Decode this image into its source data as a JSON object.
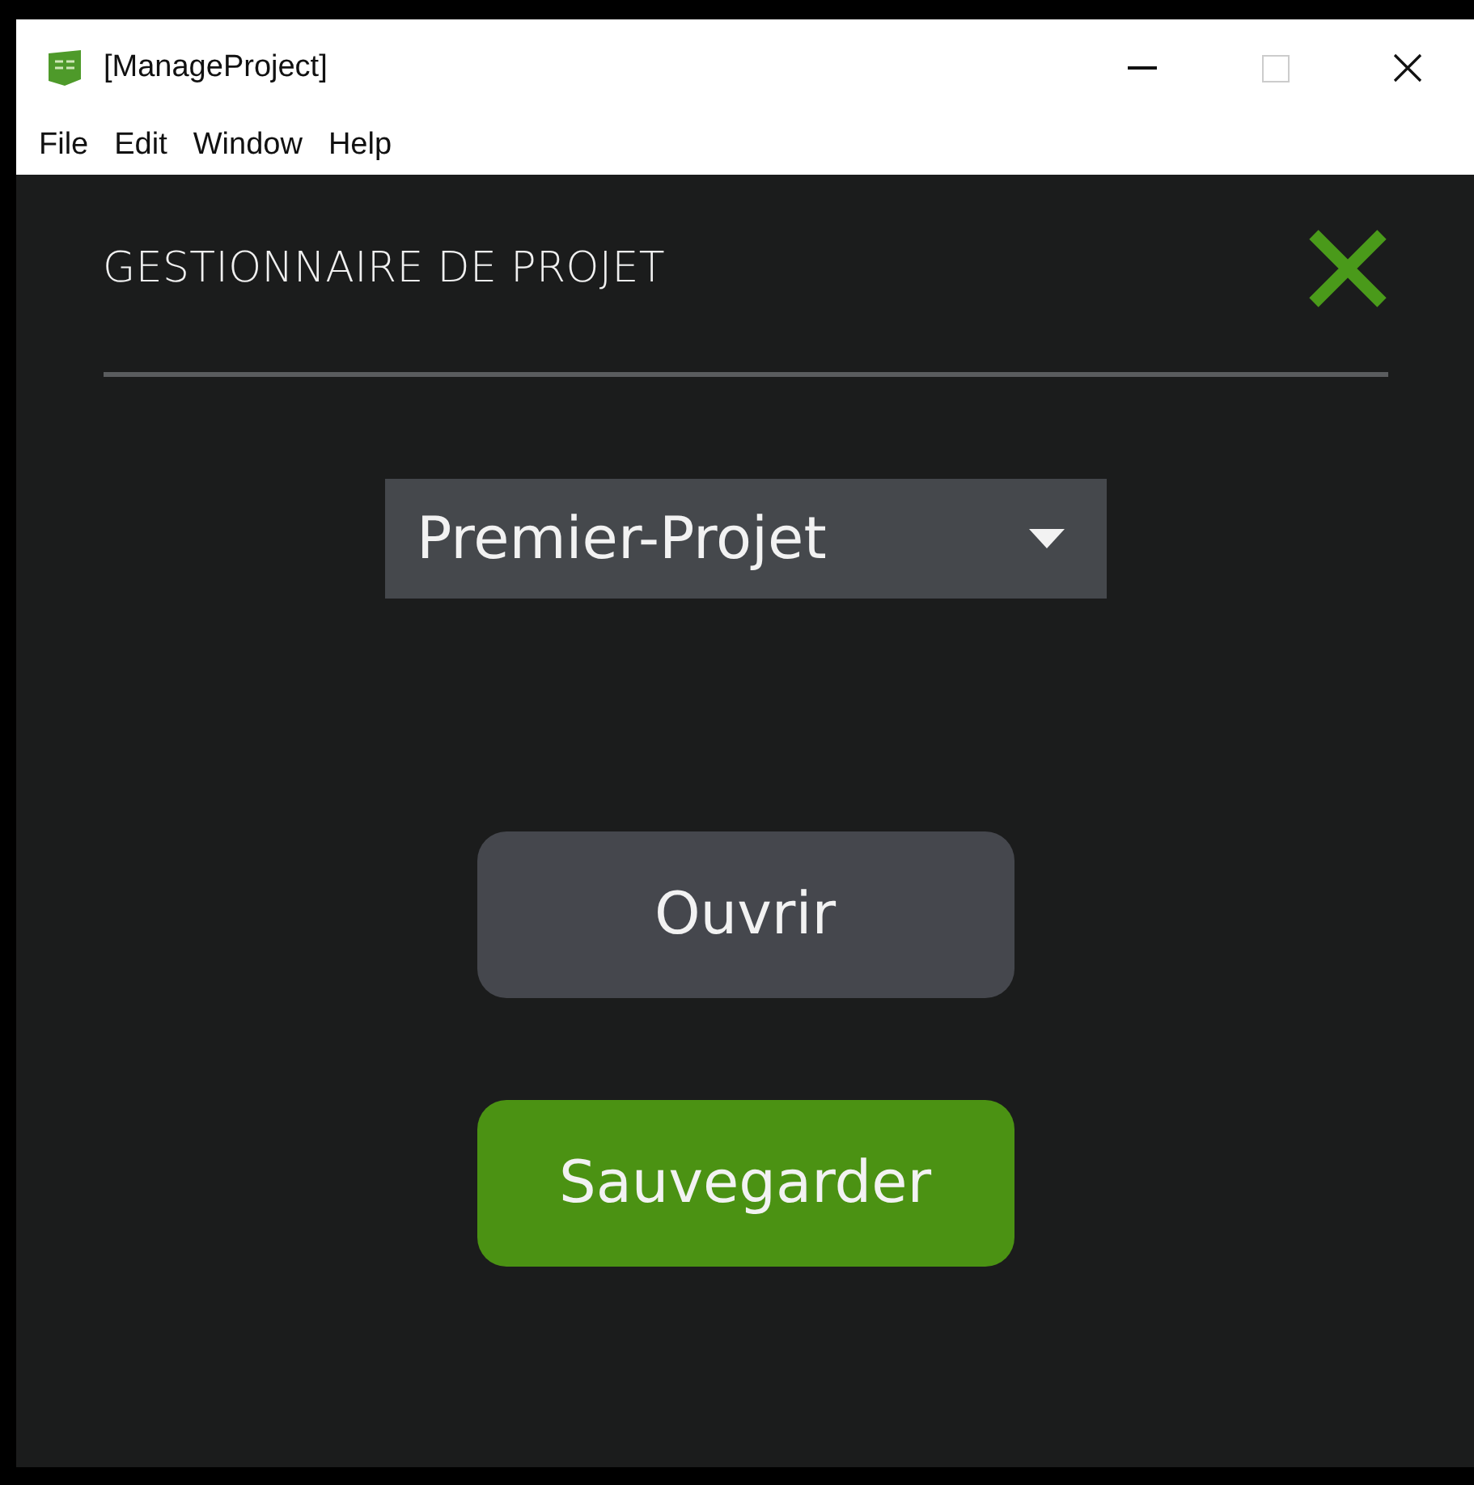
{
  "window": {
    "title": "[ManageProject]"
  },
  "menu": [
    "File",
    "Edit",
    "Window",
    "Help"
  ],
  "panel": {
    "title": "GESTIONNAIRE DE PROJET",
    "project_select": {
      "value": "Premier-Projet"
    },
    "buttons": [
      {
        "label": "Ouvrir",
        "kind": "secondary"
      },
      {
        "label": "Sauvegarder",
        "kind": "primary"
      }
    ]
  }
}
